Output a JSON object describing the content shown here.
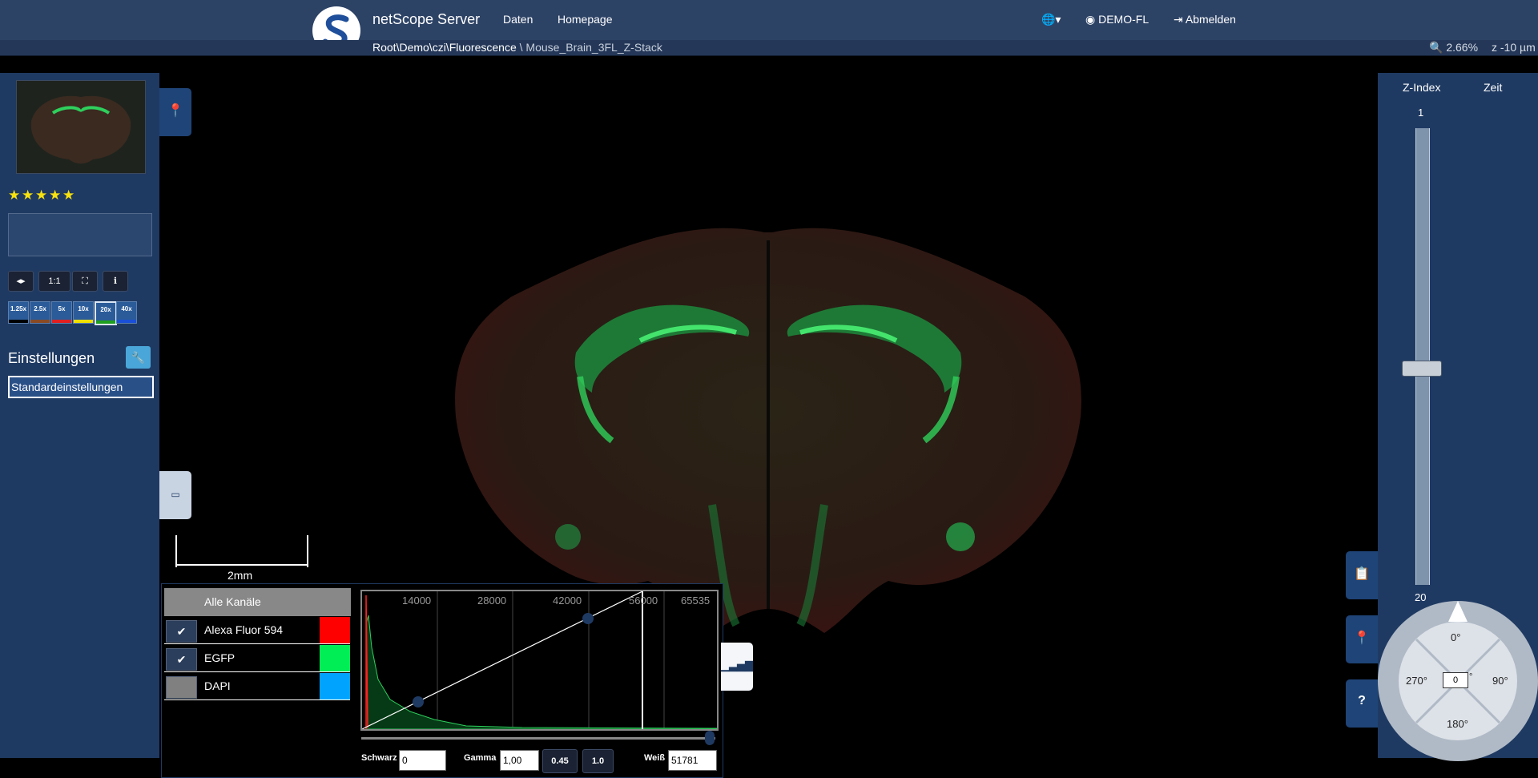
{
  "header": {
    "app_title": "netScope Server",
    "nav": [
      "Daten",
      "Homepage"
    ],
    "user": "DEMO-FL",
    "logout": "Abmelden"
  },
  "breadcrumb": {
    "path": "Root\\Demo\\czi\\Fluorescence",
    "separator": " \\ ",
    "current": "Mouse_Brain_3FL_Z-Stack"
  },
  "status": {
    "zoom": "2.66%",
    "z": "z -10 µm"
  },
  "left": {
    "stars": [
      "★",
      "★",
      "★",
      "★",
      "★"
    ],
    "toolbar": [
      "1:1"
    ],
    "objectives": [
      {
        "label": "1.25x",
        "color": "#000000"
      },
      {
        "label": "2.5x",
        "color": "#8a4a23"
      },
      {
        "label": "5x",
        "color": "#e02020"
      },
      {
        "label": "10x",
        "color": "#f0e000"
      },
      {
        "label": "20x",
        "color": "#1ea01e"
      },
      {
        "label": "40x",
        "color": "#1a4fd8"
      }
    ],
    "settings_title": "Einstellungen",
    "preset": "Standardeinstellungen"
  },
  "scale": {
    "label": "2mm"
  },
  "channels": {
    "all_label": "Alle Kanäle",
    "items": [
      {
        "name": "Alexa Fluor 594",
        "checked": true,
        "color": "#ff0000"
      },
      {
        "name": "EGFP",
        "checked": true,
        "color": "#00ee55"
      },
      {
        "name": "DAPI",
        "checked": false,
        "color": "#00a4ff"
      }
    ]
  },
  "histogram": {
    "ticks": [
      "14000",
      "28000",
      "42000",
      "56000",
      "65535"
    ],
    "black_label": "Schwarz",
    "black_value": "0",
    "gamma_label": "Gamma",
    "gamma_value": "1,00",
    "gamma_presets": [
      "0.45",
      "1.0"
    ],
    "white_label": "Weiß",
    "white_value": "51781"
  },
  "right": {
    "z_index_label": "Z-Index",
    "time_label": "Zeit",
    "z_top": "1",
    "z_bottom": "20",
    "rotation": {
      "n": "0°",
      "e": "90°",
      "s": "180°",
      "w": "270°",
      "value": "0",
      "unit": "°"
    }
  },
  "colors": {
    "nav": "#2d4366",
    "panel": "#1f3a62",
    "accent": "#4aa6d8"
  }
}
